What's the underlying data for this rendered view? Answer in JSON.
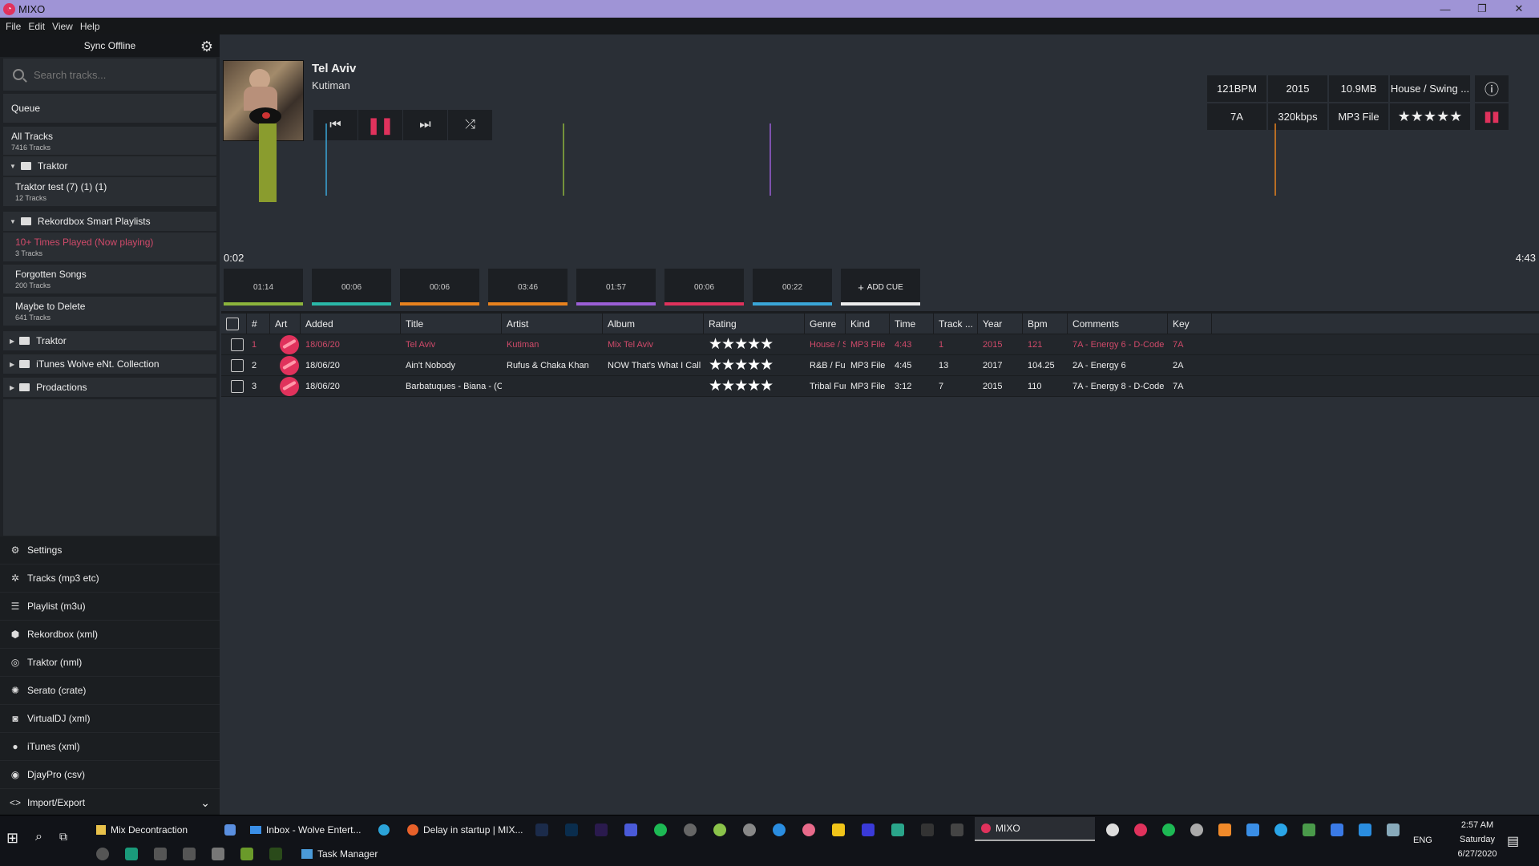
{
  "window": {
    "title": "MIXO",
    "minimize": "—",
    "restore": "❐",
    "close": "✕"
  },
  "menu": [
    "File",
    "Edit",
    "View",
    "Help"
  ],
  "sidebar": {
    "sync_label": "Sync Offline",
    "search_placeholder": "Search tracks...",
    "queue": "Queue",
    "all_tracks": {
      "label": "All Tracks",
      "count": "7416 Tracks"
    },
    "folder_traktor": "Traktor",
    "traktor_test": {
      "label": "Traktor test (7) (1) (1)",
      "count": "12 Tracks"
    },
    "folder_rekordbox": "Rekordbox Smart Playlists",
    "now_playing": {
      "label": "10+ Times Played (Now playing)",
      "count": "3 Tracks"
    },
    "forgotten": {
      "label": "Forgotten Songs",
      "count": "200 Tracks"
    },
    "maybe_delete": {
      "label": "Maybe to Delete",
      "count": "641 Tracks"
    },
    "folder_traktor2": "Traktor",
    "folder_itunes": "iTunes Wolve eNt. Collection",
    "folder_prodactions": "Prodactions",
    "bottom": [
      {
        "label": "Settings",
        "icon": "gear-icon"
      },
      {
        "label": "Tracks (mp3 etc)",
        "icon": "tracks-icon"
      },
      {
        "label": "Playlist (m3u)",
        "icon": "playlist-icon"
      },
      {
        "label": "Rekordbox (xml)",
        "icon": "rekordbox-icon"
      },
      {
        "label": "Traktor (nml)",
        "icon": "traktor-icon"
      },
      {
        "label": "Serato (crate)",
        "icon": "serato-icon"
      },
      {
        "label": "VirtualDJ (xml)",
        "icon": "virtualdj-icon"
      },
      {
        "label": "iTunes (xml)",
        "icon": "apple-icon"
      },
      {
        "label": "DjayPro (csv)",
        "icon": "djaypro-icon"
      },
      {
        "label": "Import/Export",
        "icon": "code-icon"
      }
    ]
  },
  "player": {
    "title": "Tel Aviv",
    "artist": "Kutiman",
    "elapsed": "0:02",
    "duration": "4:43",
    "info": {
      "bpm": "121BPM",
      "year": "2015",
      "size": "10.9MB",
      "genre": "House / Swing ...",
      "key": "7A",
      "bitrate": "320kbps",
      "kind": "MP3 File",
      "rating": "★★★★★"
    },
    "cues": [
      {
        "time": "01:14",
        "color": "#8cb43c"
      },
      {
        "time": "00:06",
        "color": "#2ab8a8"
      },
      {
        "time": "00:06",
        "color": "#e8821e"
      },
      {
        "time": "03:46",
        "color": "#e8821e"
      },
      {
        "time": "01:57",
        "color": "#9b5fd6"
      },
      {
        "time": "00:06",
        "color": "#e0325c"
      },
      {
        "time": "00:22",
        "color": "#3aa6d8"
      }
    ],
    "add_cue": "ADD CUE"
  },
  "table": {
    "headers": [
      "#",
      "Art",
      "Added",
      "Title",
      "Artist",
      "Album",
      "Rating",
      "Genre",
      "Kind",
      "Time",
      "Track ...",
      "Year",
      "Bpm",
      "Comments",
      "Key"
    ],
    "rows": [
      {
        "num": "1",
        "added": "18/06/20",
        "title": "Tel Aviv",
        "artist": "Kutiman",
        "album": "Mix Tel Aviv",
        "rating": "★★★★★",
        "genre": "House / Swing",
        "kind": "MP3 File",
        "time": "4:43",
        "track": "1",
        "year": "2015",
        "bpm": "121",
        "comments": "7A - Energy 6 - D-Code",
        "key": "7A"
      },
      {
        "num": "2",
        "added": "18/06/20",
        "title": "Ain't Nobody",
        "artist": "Rufus & Chaka Khan",
        "album": "NOW That's What I Call",
        "rating": "★★★★★",
        "genre": "R&B / Funk",
        "kind": "MP3 File",
        "time": "4:45",
        "track": "13",
        "year": "2017",
        "bpm": "104.25",
        "comments": "2A - Energy 6",
        "key": "2A"
      },
      {
        "num": "3",
        "added": "18/06/20",
        "title": "Barbatuques - Biana - (C",
        "artist": "",
        "album": "",
        "rating": "★★★★★",
        "genre": "Tribal Funk",
        "kind": "MP3 File",
        "time": "3:12",
        "track": "7",
        "year": "2015",
        "bpm": "110",
        "comments": "7A - Energy 8 - D-Code",
        "key": "7A"
      }
    ]
  },
  "taskbar": {
    "row1": [
      "Mix Decontraction",
      "Inbox - Wolve Entert...",
      "Delay in startup | MIX...",
      "MIXO"
    ],
    "row2": [
      "Task Manager"
    ],
    "lang": "ENG",
    "time": "2:57 AM",
    "day": "Saturday",
    "date": "6/27/2020"
  }
}
